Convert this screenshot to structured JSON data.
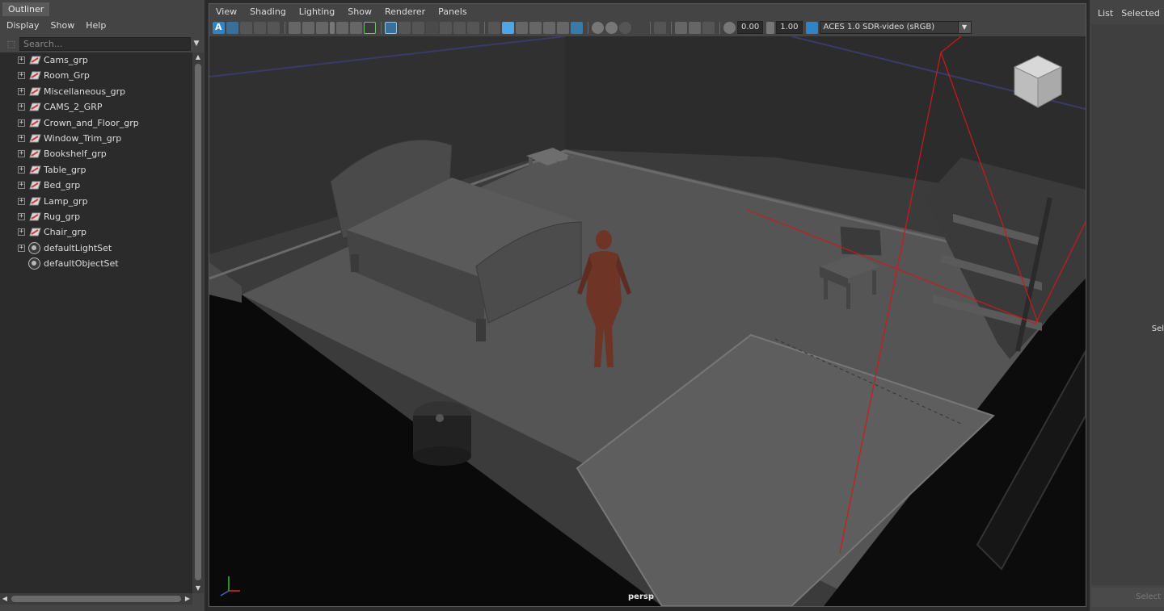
{
  "outliner": {
    "title": "Outliner",
    "menu": [
      "Display",
      "Show",
      "Help"
    ],
    "search_placeholder": "Search...",
    "items": [
      {
        "label": "Cams_grp",
        "kind": "group",
        "expandable": true
      },
      {
        "label": "Room_Grp",
        "kind": "group",
        "expandable": true
      },
      {
        "label": "Miscellaneous_grp",
        "kind": "group",
        "expandable": true
      },
      {
        "label": "CAMS_2_GRP",
        "kind": "group",
        "expandable": true
      },
      {
        "label": "Crown_and_Floor_grp",
        "kind": "group",
        "expandable": true
      },
      {
        "label": "Window_Trim_grp",
        "kind": "group",
        "expandable": true
      },
      {
        "label": "Bookshelf_grp",
        "kind": "group",
        "expandable": true
      },
      {
        "label": "Table_grp",
        "kind": "group",
        "expandable": true
      },
      {
        "label": "Bed_grp",
        "kind": "group",
        "expandable": true
      },
      {
        "label": "Lamp_grp",
        "kind": "group",
        "expandable": true
      },
      {
        "label": "Rug_grp",
        "kind": "group",
        "expandable": true
      },
      {
        "label": "Chair_grp",
        "kind": "group",
        "expandable": true
      },
      {
        "label": "defaultLightSet",
        "kind": "set",
        "expandable": true
      },
      {
        "label": "defaultObjectSet",
        "kind": "set",
        "expandable": false
      }
    ]
  },
  "viewport": {
    "menu": [
      "View",
      "Shading",
      "Lighting",
      "Show",
      "Renderer",
      "Panels"
    ],
    "exposure": "0.00",
    "gamma": "1.00",
    "color_transform": "ACES 1.0 SDR-video (sRGB)",
    "camera": "persp"
  },
  "right_panel": {
    "tabs": [
      "List",
      "Selected"
    ],
    "side_label": "Sel",
    "button": "Select"
  },
  "colors": {
    "accent": "#4da6e8",
    "camera_lines": "#d01818",
    "figure": "#6e3527"
  }
}
